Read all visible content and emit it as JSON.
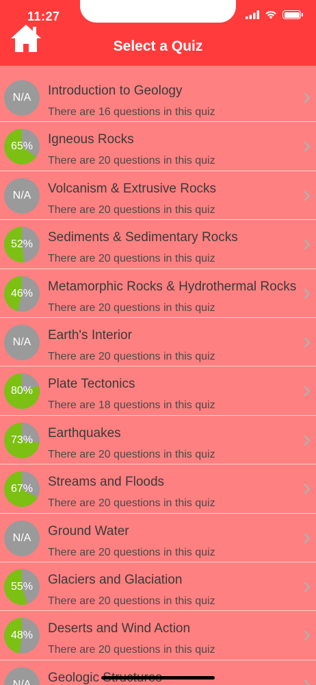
{
  "status_bar": {
    "time": "11:27"
  },
  "header": {
    "title": "Select a Quiz"
  },
  "colors": {
    "header": "#ff3b3b",
    "background": "#ff8080",
    "badge_gray": "#9a9a9a",
    "badge_green": "#7cc013"
  },
  "quizzes": [
    {
      "title": "Introduction to Geology",
      "subtitle": "There are 16 questions in this quiz",
      "score_label": "N/A",
      "score": null
    },
    {
      "title": "Igneous Rocks",
      "subtitle": "There are 20 questions in this quiz",
      "score_label": "65%",
      "score": 0.65
    },
    {
      "title": "Volcanism & Extrusive Rocks",
      "subtitle": "There are 20 questions in this quiz",
      "score_label": "N/A",
      "score": null
    },
    {
      "title": "Sediments & Sedimentary Rocks",
      "subtitle": "There are 20 questions in this quiz",
      "score_label": "52%",
      "score": 0.52
    },
    {
      "title": "Metamorphic Rocks & Hydrothermal Rocks",
      "subtitle": "There are 20 questions in this quiz",
      "score_label": "46%",
      "score": 0.46
    },
    {
      "title": "Earth's Interior",
      "subtitle": "There are 20 questions in this quiz",
      "score_label": "N/A",
      "score": null
    },
    {
      "title": "Plate Tectonics",
      "subtitle": "There are 18 questions in this quiz",
      "score_label": "80%",
      "score": 0.8
    },
    {
      "title": "Earthquakes",
      "subtitle": "There are 20 questions in this quiz",
      "score_label": "73%",
      "score": 0.73
    },
    {
      "title": "Streams and Floods",
      "subtitle": "There are 20 questions in this quiz",
      "score_label": "67%",
      "score": 0.67
    },
    {
      "title": "Ground Water",
      "subtitle": "There are 20 questions in this quiz",
      "score_label": "N/A",
      "score": null
    },
    {
      "title": "Glaciers and Glaciation",
      "subtitle": "There are 20 questions in this quiz",
      "score_label": "55%",
      "score": 0.55
    },
    {
      "title": "Deserts and Wind Action",
      "subtitle": "There are 20 questions in this quiz",
      "score_label": "48%",
      "score": 0.48
    },
    {
      "title": "Geologic Structures",
      "subtitle": "",
      "score_label": "N/A",
      "score": null
    }
  ]
}
